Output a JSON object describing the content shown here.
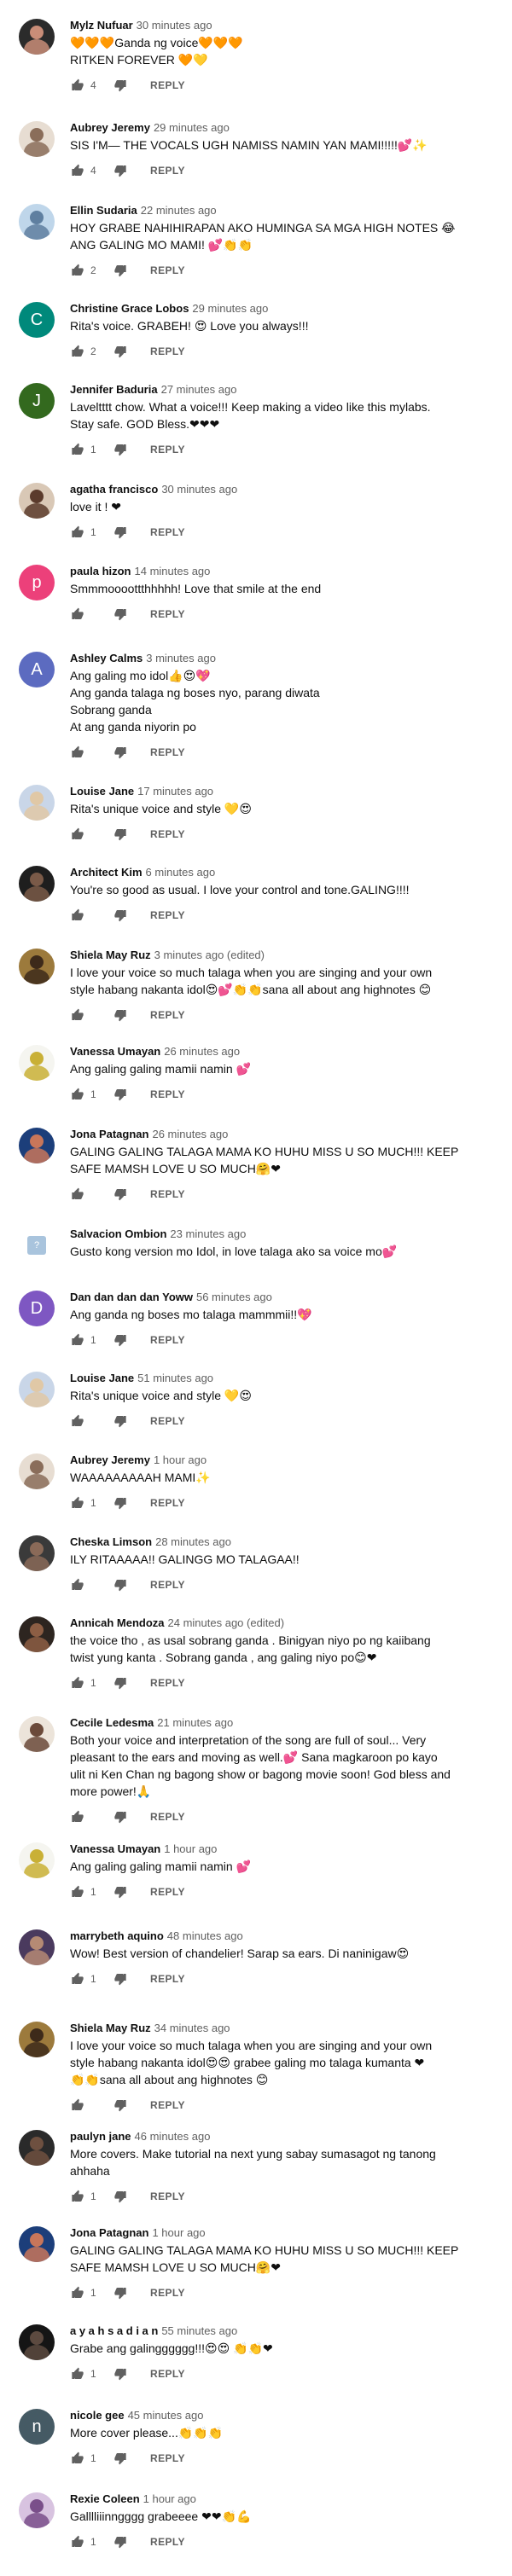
{
  "colors": {
    "author": "#0f0f0f",
    "meta": "#606060",
    "text": "#0f0f0f",
    "icon": "#606060"
  },
  "reply_label": "REPLY",
  "comments": [
    {
      "author": "Mylz Nufuar",
      "time": "30 minutes ago",
      "text": "🧡🧡🧡Ganda ng voice🧡🧡🧡\nRITKEN FOREVER 🧡💛",
      "likes": "4",
      "avatar": {
        "kind": "photo",
        "c1": "#2b2b2b",
        "c2": "#c98d78"
      }
    },
    {
      "author": "Aubrey Jeremy",
      "time": "29 minutes ago",
      "text": "SIS I'M— THE VOCALS UGH NAMISS NAMIN YAN MAMI!!!!!💕✨",
      "likes": "4",
      "avatar": {
        "kind": "photo",
        "c1": "#e7ddd2",
        "c2": "#8a6d5a"
      }
    },
    {
      "author": "Ellin Sudaria",
      "time": "22 minutes ago",
      "text": "HOY GRABE NAHIHIRAPAN AKO HUMINGA SA MGA HIGH NOTES 😂\nANG GALING MO MAMI! 💕👏👏",
      "likes": "2",
      "avatar": {
        "kind": "photo",
        "c1": "#bfd6ea",
        "c2": "#5f7fa0"
      }
    },
    {
      "author": "Christine Grace Lobos",
      "time": "29 minutes ago",
      "text": "Rita's voice. GRABEH! 😍 Love you always!!!",
      "likes": "2",
      "avatar": {
        "kind": "letter",
        "letter": "C",
        "bg": "#00897b"
      }
    },
    {
      "author": "Jennifer Baduria",
      "time": "27 minutes ago",
      "text": "Laveltttt chow. What a voice!!! Keep making a video like this mylabs.\nStay safe. GOD Bless.❤❤❤",
      "likes": "1",
      "avatar": {
        "kind": "letter",
        "letter": "J",
        "bg": "#33691e"
      }
    },
    {
      "author": "agatha francisco",
      "time": "30 minutes ago",
      "text": "love it ! ❤",
      "likes": "1",
      "avatar": {
        "kind": "photo",
        "c1": "#d9c8b6",
        "c2": "#5b3b2c"
      }
    },
    {
      "author": "paula hizon",
      "time": "14 minutes ago",
      "text": "Smmmoooottthhhhh! Love that smile at the end",
      "likes": "",
      "avatar": {
        "kind": "letter",
        "letter": "p",
        "bg": "#ec407a"
      }
    },
    {
      "author": "Ashley Calms",
      "time": "3 minutes ago",
      "text": "Ang galing mo idol👍😍💖\nAng ganda talaga ng boses nyo, parang diwata\nSobrang ganda\nAt ang ganda niyorin po",
      "likes": "",
      "avatar": {
        "kind": "letter",
        "letter": "A",
        "bg": "#5c6bc0"
      }
    },
    {
      "author": "Louise Jane",
      "time": "17 minutes ago",
      "text": "Rita's unique voice and style 💛😍",
      "likes": "",
      "avatar": {
        "kind": "photo",
        "c1": "#c9d6e8",
        "c2": "#e0c8a6"
      }
    },
    {
      "author": "Architect Kim",
      "time": "6 minutes ago",
      "text": "You're so good as usual. I love your control and tone.GALING!!!!",
      "likes": "",
      "avatar": {
        "kind": "photo",
        "c1": "#1e1e1e",
        "c2": "#7a5a48"
      }
    },
    {
      "author": "Shiela May Ruz",
      "time": "3 minutes ago (edited)",
      "text": "I love your voice so much talaga when you are singing and your own\nstyle habang nakanta idol😍💕👏👏sana all about ang highnotes 😊",
      "likes": "",
      "avatar": {
        "kind": "photo",
        "c1": "#9c7a3c",
        "c2": "#3d2a1a"
      }
    },
    {
      "author": "Vanessa Umayan",
      "time": "26 minutes ago",
      "text": "Ang galing galing mamii namin 💕",
      "likes": "1",
      "avatar": {
        "kind": "photo",
        "c1": "#f5f5f0",
        "c2": "#c9b036"
      }
    },
    {
      "author": "Jona Patagnan",
      "time": "26 minutes ago",
      "text": "GALING GALING TALAGA MAMA KO HUHU MISS U SO MUCH!!! KEEP\nSAFE MAMSH LOVE U SO MUCH🤗❤",
      "likes": "",
      "avatar": {
        "kind": "photo",
        "c1": "#1c3e7a",
        "c2": "#c8765a"
      }
    },
    {
      "author": "Salvacion Ombion",
      "time": "23 minutes ago",
      "text": "Gusto kong version mo Idol, in love talaga ako sa voice mo💕",
      "likes": null,
      "avatar": {
        "kind": "square",
        "letter": "?",
        "bg": "#a9c4dd"
      }
    },
    {
      "author": "Dan dan dan dan Yoww",
      "time": "56 minutes ago",
      "text": "Ang ganda ng boses mo talaga mammmii!!💖",
      "likes": "1",
      "avatar": {
        "kind": "letter",
        "letter": "D",
        "bg": "#7e57c2"
      }
    },
    {
      "author": "Louise Jane",
      "time": "51 minutes ago",
      "text": "Rita's unique voice and style 💛😍",
      "likes": "",
      "avatar": {
        "kind": "photo",
        "c1": "#c9d6e8",
        "c2": "#e0c8a6"
      }
    },
    {
      "author": "Aubrey Jeremy",
      "time": "1 hour ago",
      "text": "WAAAAAAAAAH MAMI✨",
      "likes": "1",
      "avatar": {
        "kind": "photo",
        "c1": "#e7ddd2",
        "c2": "#8a6d5a"
      }
    },
    {
      "author": "Cheska Limson",
      "time": "28 minutes ago",
      "text": "ILY RITAAAAA!! GALINGG MO TALAGAA!!",
      "likes": "",
      "avatar": {
        "kind": "photo",
        "c1": "#3a3a3a",
        "c2": "#8a6a58"
      }
    },
    {
      "author": "Annicah Mendoza",
      "time": "24 minutes ago (edited)",
      "text": "the voice tho , as usal sobrang ganda . Binigyan niyo po ng kaiibang\ntwist yung kanta . Sobrang ganda , ang galing niyo po😊❤",
      "likes": "1",
      "avatar": {
        "kind": "photo",
        "c1": "#2d2520",
        "c2": "#8d5e44"
      }
    },
    {
      "author": "Cecile Ledesma",
      "time": "21 minutes ago",
      "text": "Both your voice and interpretation of the song are full of soul... Very\npleasant to the ears and moving as well.💕 Sana magkaroon po kayo\nulit ni Ken Chan ng bagong show or bagong movie soon! God bless and\nmore power!🙏",
      "likes": "",
      "avatar": {
        "kind": "photo",
        "c1": "#ece4da",
        "c2": "#6b4a3a"
      }
    },
    {
      "author": "Vanessa Umayan",
      "time": "1 hour ago",
      "text": "Ang galing galing mamii namin 💕",
      "likes": "1",
      "avatar": {
        "kind": "photo",
        "c1": "#f5f5f0",
        "c2": "#c9b036"
      }
    },
    {
      "author": "marrybeth aquino",
      "time": "48 minutes ago",
      "text": "Wow! Best version of chandelier! Sarap sa ears. Di naninigaw😍",
      "likes": "1",
      "avatar": {
        "kind": "photo",
        "c1": "#4a3a5e",
        "c2": "#b58a74"
      }
    },
    {
      "author": "Shiela May Ruz",
      "time": "34 minutes ago",
      "text": "I love your voice so much talaga when you are singing and your own\nstyle habang nakanta idol😍😍 grabee galing mo talaga kumanta ❤\n👏👏sana all about ang highnotes 😊",
      "likes": "",
      "avatar": {
        "kind": "photo",
        "c1": "#9c7a3c",
        "c2": "#3d2a1a"
      }
    },
    {
      "author": "paulyn jane",
      "time": "46 minutes ago",
      "text": "More covers. Make tutorial na next yung sabay sumasagot ng tanong\nahhaha",
      "likes": "1",
      "avatar": {
        "kind": "photo",
        "c1": "#2a2a2a",
        "c2": "#6e5040"
      }
    },
    {
      "author": "Jona Patagnan",
      "time": "1 hour ago",
      "text": "GALING GALING TALAGA MAMA KO HUHU MISS U SO MUCH!!! KEEP\nSAFE MAMSH LOVE U SO MUCH🤗❤",
      "likes": "1",
      "avatar": {
        "kind": "photo",
        "c1": "#1c3e7a",
        "c2": "#c8765a"
      }
    },
    {
      "author": "a y a h s a d i a n",
      "time": "55 minutes ago",
      "text": "Grabe ang galingggggg!!!😍😍 👏👏❤",
      "likes": "1",
      "avatar": {
        "kind": "photo",
        "c1": "#151515",
        "c2": "#5c4a40"
      }
    },
    {
      "author": "nicole gee",
      "time": "45 minutes ago",
      "text": "More cover please...👏👏👏",
      "likes": "1",
      "avatar": {
        "kind": "letter",
        "letter": "n",
        "bg": "#455a64"
      }
    },
    {
      "author": "Rexie Coleen",
      "time": "1 hour ago",
      "text": "Galllliiinngggg grabeeee ❤❤👏💪",
      "likes": "1",
      "avatar": {
        "kind": "photo",
        "c1": "#d8c3e0",
        "c2": "#7a4f8a"
      }
    }
  ]
}
